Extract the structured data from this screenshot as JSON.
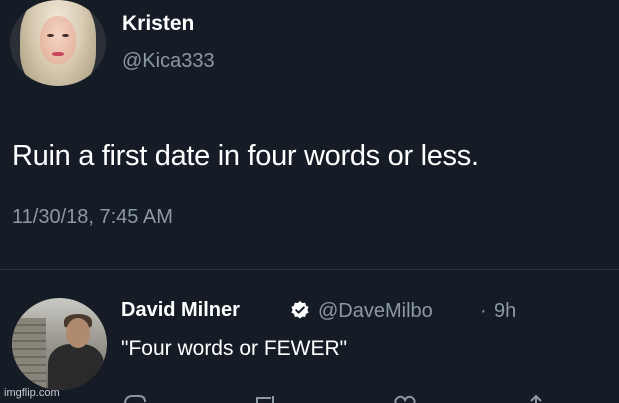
{
  "tweet": {
    "author_name": "Kristen",
    "author_handle": "@Kica333",
    "text": "Ruin a first date in four words or less.",
    "timestamp": "11/30/18, 7:45 AM"
  },
  "reply": {
    "author_name": "David Milner",
    "verified_icon": "verified-badge-icon",
    "author_handle": "@DaveMilbo",
    "separator": "·",
    "age": "9h",
    "text": "\"Four words or FEWER\"",
    "actions": [
      "reply-icon",
      "retweet-icon",
      "like-icon",
      "share-icon"
    ]
  },
  "watermark": "imgflip.com",
  "colors": {
    "background": "#151c26",
    "primary_text": "#ffffff",
    "secondary_text": "#8b98a5",
    "divider": "#2a333d"
  }
}
